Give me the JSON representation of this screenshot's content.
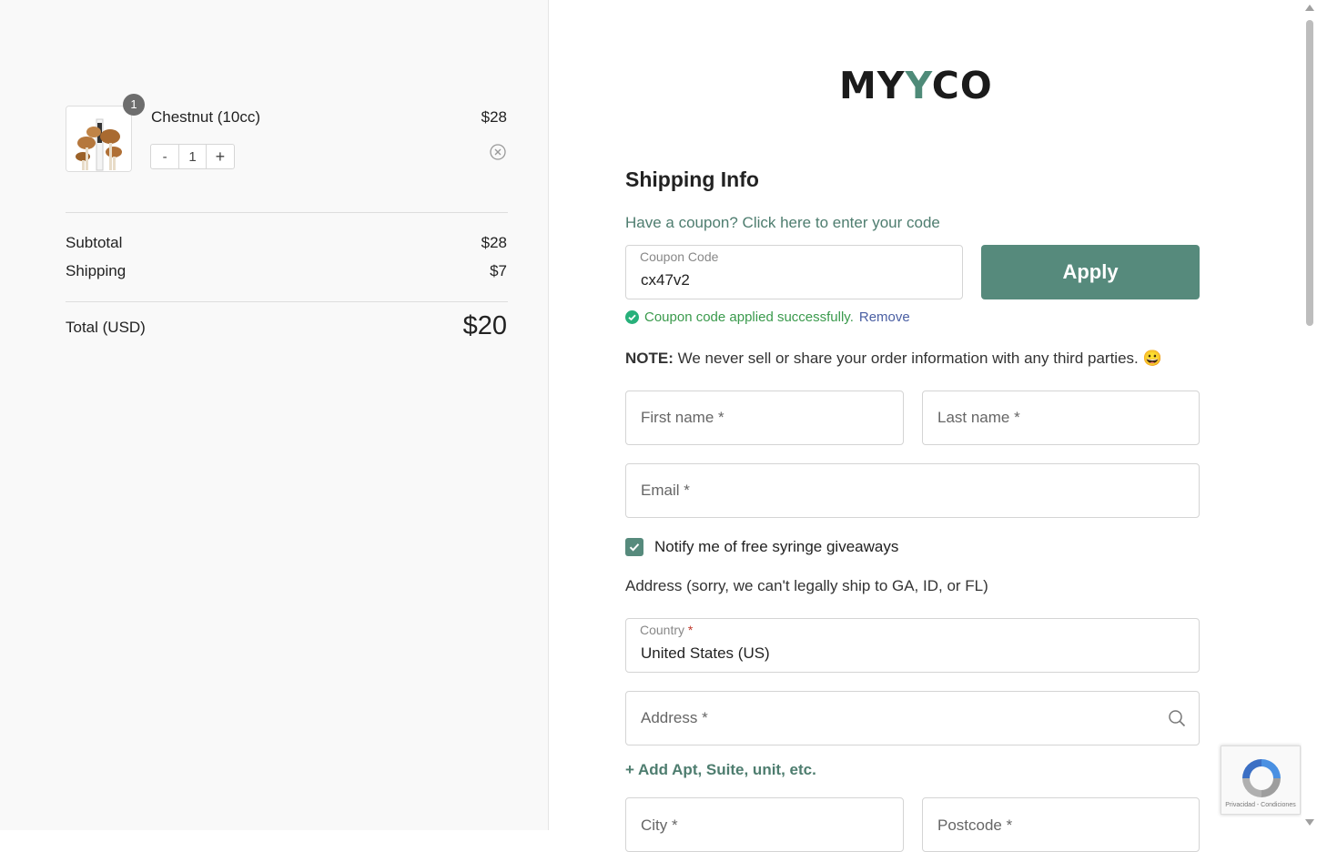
{
  "cart": {
    "item": {
      "name": "Chestnut (10cc)",
      "price": "$28",
      "quantity": "1",
      "badge_count": "1",
      "minus_label": "-",
      "plus_label": "+"
    },
    "subtotal_label": "Subtotal",
    "subtotal_value": "$28",
    "shipping_label": "Shipping",
    "shipping_value": "$7",
    "total_label": "Total (USD)",
    "total_value": "$20"
  },
  "brand": {
    "logo_left": "MY",
    "logo_y": "Y",
    "logo_right": "CO"
  },
  "form": {
    "title": "Shipping Info",
    "coupon_link": "Have a coupon? Click here to enter your code",
    "coupon": {
      "label": "Coupon Code",
      "value": "cx47v2",
      "apply_label": "Apply",
      "success_message": "Coupon code applied successfully.",
      "remove_label": "Remove"
    },
    "note_prefix": "NOTE:",
    "note_text": "We never sell or share your order information with any third parties. 😀",
    "first_name_ph": "First name *",
    "last_name_ph": "Last name *",
    "email_ph": "Email *",
    "notify_label": "Notify me of free syringe giveaways",
    "notify_checked": true,
    "address_note": "Address (sorry, we can't legally ship to GA, ID, or FL)",
    "country_label": "Country",
    "country_required": "*",
    "country_value": "United States (US)",
    "address_ph": "Address *",
    "add_apt_label": "+ Add Apt, Suite, unit, etc.",
    "city_ph": "City *",
    "postcode_ph": "Postcode *"
  },
  "recaptcha": {
    "fine_print": "Privacidad - Condiciones"
  },
  "colors": {
    "accent": "#568a7c",
    "link": "#4e7d6f",
    "success": "#3a9a4c"
  }
}
